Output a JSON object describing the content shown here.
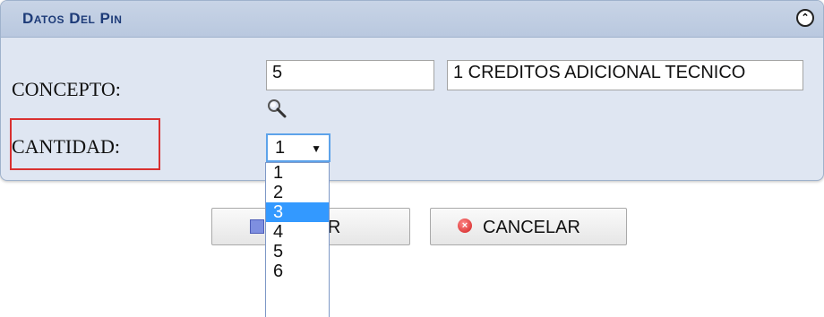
{
  "panel": {
    "title": "Datos Del Pin",
    "collapse_icon": "collapse-up-icon"
  },
  "form": {
    "concepto_label": "CONCEPTO:",
    "concepto_code": "5",
    "concepto_description": "1 CREDITOS ADICIONAL TECNICO",
    "search_icon": "magnifier-icon",
    "cantidad_label": "CANTIDAD:",
    "cantidad_value": "1",
    "cantidad_options": [
      "1",
      "2",
      "3",
      "4",
      "5",
      "6"
    ],
    "cantidad_highlighted": "3"
  },
  "buttons": {
    "save_label": "IAR",
    "cancel_label": "CANCELAR"
  },
  "colors": {
    "highlight": "#3399ff",
    "label_outline": "#d93131",
    "panel_header_text": "#1d3b78"
  }
}
